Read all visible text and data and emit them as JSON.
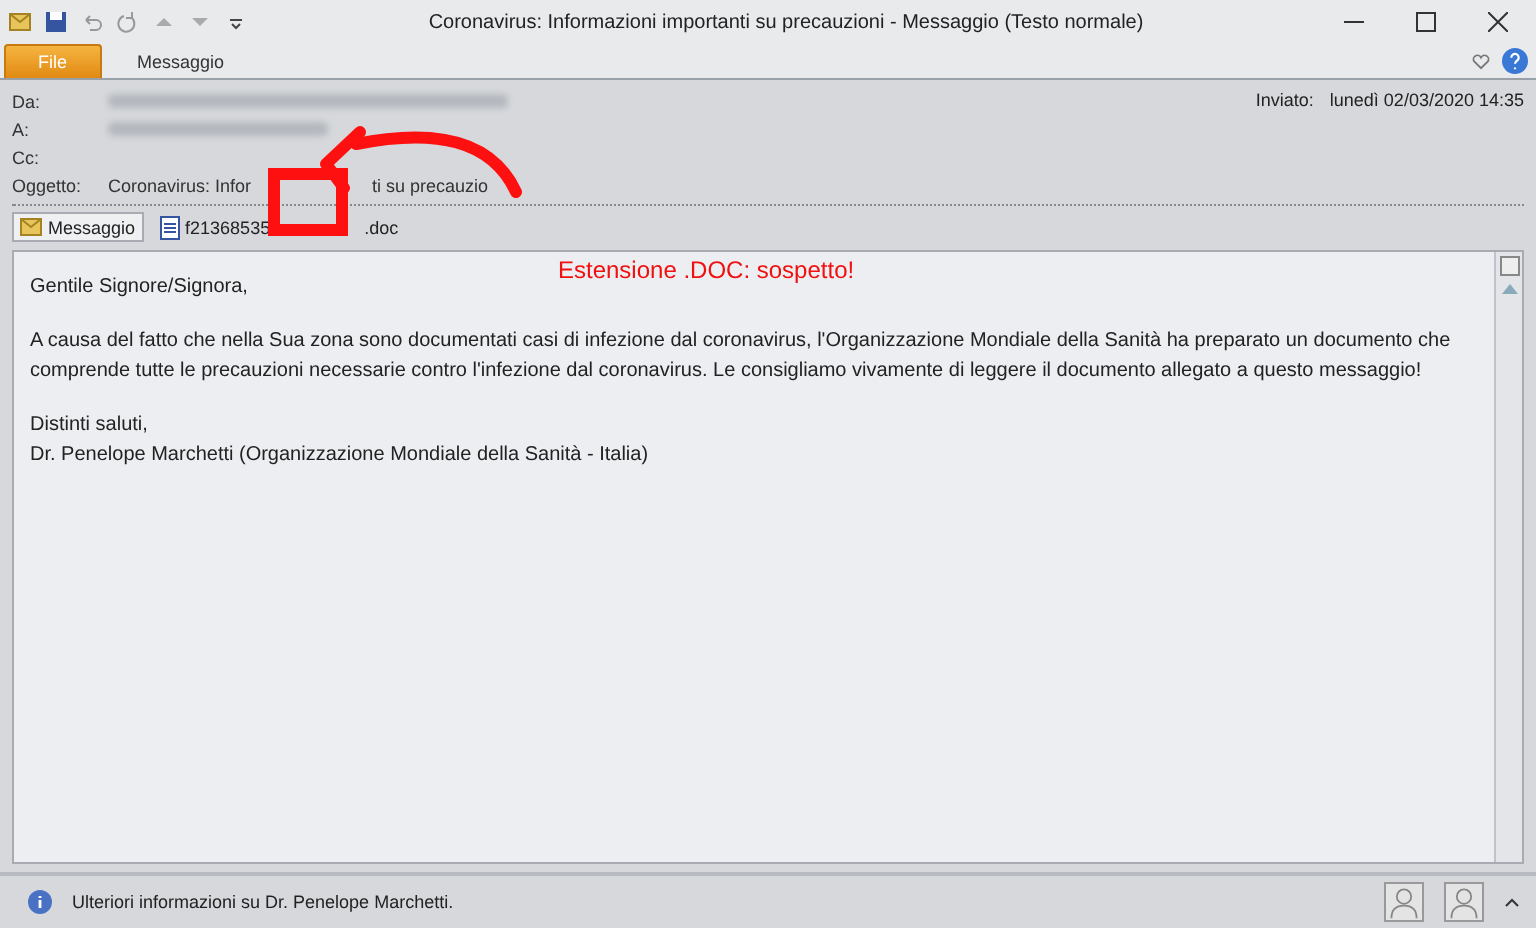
{
  "window": {
    "title": "Coronavirus: Informazioni importanti su precauzioni  -  Messaggio (Testo normale)"
  },
  "ribbon_tabs": [
    {
      "label": "File",
      "selected": true
    },
    {
      "label": "Messaggio",
      "selected": false
    }
  ],
  "header": {
    "fields": [
      {
        "label": "Da:",
        "value_blurred": true
      },
      {
        "label": "A:",
        "value_blurred": true
      },
      {
        "label": "Cc:",
        "value_blurred": false
      }
    ],
    "subject_label": "Oggetto:",
    "subject_parts": [
      "Coronavirus: Infor",
      "ti su precauzio"
    ],
    "sent_label": "Inviato:",
    "sent_value": "lunedì 02/03/2020 14:35"
  },
  "attachments": [
    {
      "label": "Messaggio",
      "kind": "message",
      "selected": true
    },
    {
      "label": "f21368535",
      "label_tail": ".doc",
      "kind": "file",
      "selected": false
    }
  ],
  "annotation": {
    "text": "Estensione .DOC: sospetto!"
  },
  "body": {
    "paragraphs": [
      "Gentile Signore/Signora,",
      "A causa del fatto che nella Sua zona sono documentati casi di infezione dal coronavirus, l'Organizzazione Mondiale della Sanità ha preparato un documento che comprende tutte le precauzioni necessarie contro l'infezione dal coronavirus. Le consigliamo vivamente di leggere il documento allegato a questo messaggio!",
      "Distinti saluti,\nDr. Penelope Marchetti (Organizzazione Mondiale della Sanità - Italia)"
    ]
  },
  "status_bar": {
    "text": "Ulteriori informazioni su Dr. Penelope Marchetti."
  }
}
